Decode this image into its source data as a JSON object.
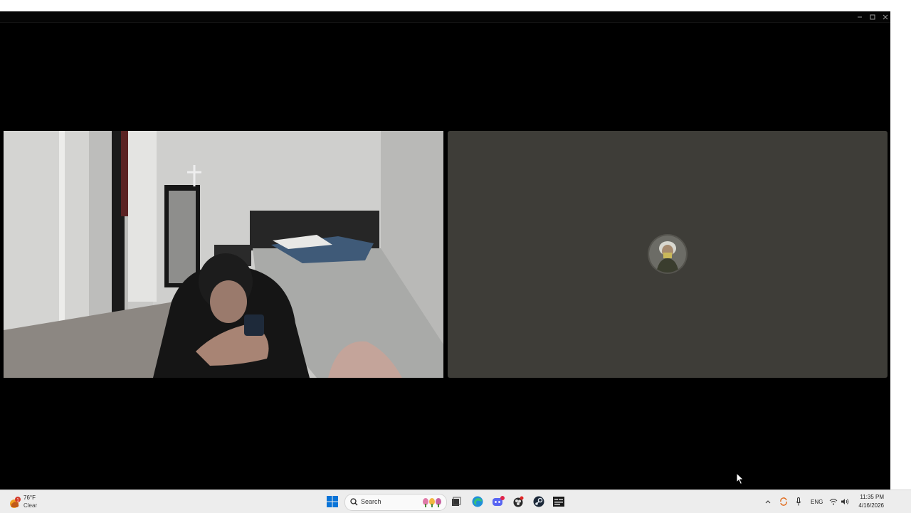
{
  "window": {
    "controls": [
      "minimize",
      "maximize",
      "close"
    ]
  },
  "video": {
    "local_participant": "camera-feed",
    "remote_participant": "avatar-only"
  },
  "taskbar": {
    "weather": {
      "temp": "76°F",
      "condition": "Clear",
      "alert_badge": "1"
    },
    "search_placeholder": "Search",
    "apps": [
      "start-icon",
      "search-icon",
      "task-view-icon",
      "edge-icon",
      "discord-icon",
      "obs-icon",
      "steam-icon",
      "terminal-icon"
    ],
    "tray": {
      "language": "ENG",
      "time": "11:35 PM",
      "date": "4/16/2026"
    }
  },
  "colors": {
    "taskbar_bg": "#ededed",
    "remote_tile_bg": "#3e3d38",
    "window_bg": "#000000"
  }
}
